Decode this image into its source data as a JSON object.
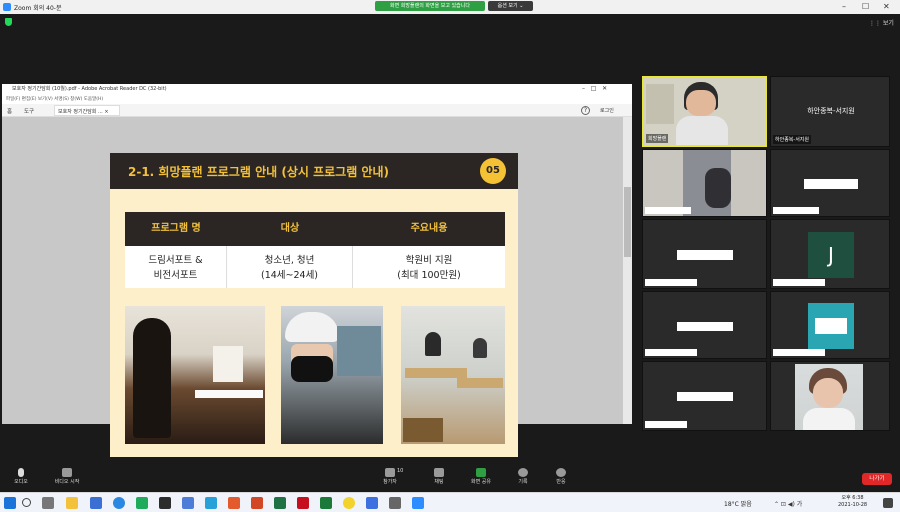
{
  "titlebar": {
    "window_title": "Zoom 회의 40-분",
    "share_banner": "화면 희망플랜의 화면을 보고 있습니다",
    "view_options": "옵션 보기 ⌄",
    "top_right_view": "⋮⋮ 보기"
  },
  "acrobat": {
    "title": "보호자 정기간담회 (10월).pdf - Adobe Acrobat Reader DC (32-bit)",
    "menu": "파일(F)   편집(E)   보기(V)   서명(S)   창(W)   도움말(H)",
    "tab_home": "홈",
    "tab_tools": "도구",
    "tab_doc": "보호자 정기간담회 ... ×",
    "login": "로그인"
  },
  "slide": {
    "title": "2-1. 희망플랜 프로그램 안내 (상시 프로그램 안내)",
    "page_number": "05",
    "headers": [
      "프로그램 명",
      "대상",
      "주요내용"
    ],
    "row": [
      "드림서포트 &\n비전서포트",
      "청소년, 청년\n(14세~24세)",
      "학원비 지원\n(최대 100만원)"
    ]
  },
  "participants": {
    "speaker_name": "희망플랜",
    "tile2_label": "하안종복-서지원",
    "tile2_name": "하안종복-서지원",
    "initial_J": "J"
  },
  "controls": {
    "audio": "오디오",
    "video": "비디오 시작",
    "participants": "참가자",
    "participants_count": "10",
    "chat": "채팅",
    "share": "화면 공유",
    "record": "기록",
    "reactions": "반응",
    "leave": "나가기"
  },
  "taskbar": {
    "weather": "18°C  맑음",
    "time": "오후 6:38",
    "date": "2021-10-28"
  },
  "colors": {
    "slide_bg": "#fcefc9",
    "slide_dark": "#2b2623",
    "slide_accent": "#f2c03c",
    "share_green": "#2ea043",
    "leave_red": "#e02828",
    "active_speaker": "#e8e63b"
  }
}
